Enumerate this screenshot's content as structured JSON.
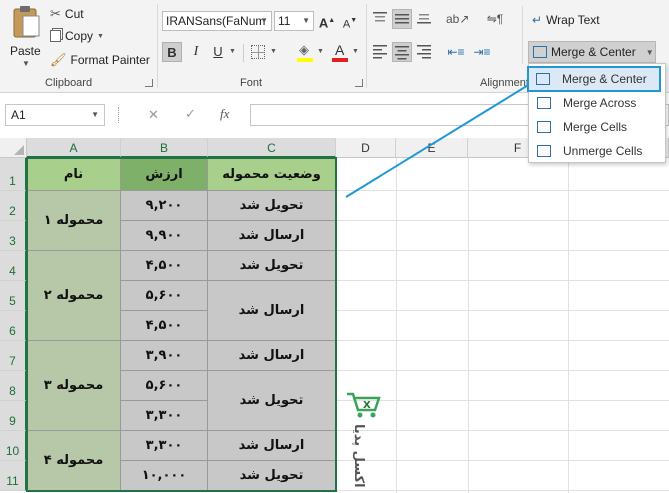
{
  "clipboard": {
    "paste_label": "Paste",
    "cut_label": "Cut",
    "copy_label": "Copy",
    "format_painter_label": "Format Painter",
    "group_label": "Clipboard"
  },
  "font": {
    "font_name": "IRANSans(FaNum",
    "font_size": "11",
    "group_label": "Font",
    "bold": "B",
    "italic": "I",
    "underline": "U",
    "grow": "A",
    "shrink": "A"
  },
  "alignment": {
    "wrap_text_label": "Wrap Text",
    "merge_center_label": "Merge & Center",
    "group_label": "Alignment"
  },
  "merge_menu": {
    "items": [
      {
        "label": "Merge & Center"
      },
      {
        "label": "Merge Across"
      },
      {
        "label": "Merge Cells"
      },
      {
        "label": "Unmerge Cells"
      }
    ]
  },
  "formula_bar": {
    "name_box": "A1",
    "fx": "fx",
    "cancel": "✕",
    "enter": "✓",
    "value": ""
  },
  "columns": [
    "A",
    "B",
    "C",
    "D",
    "E",
    "F"
  ],
  "rows": [
    "1",
    "2",
    "3",
    "4",
    "5",
    "6",
    "7",
    "8",
    "9",
    "10",
    "11"
  ],
  "table": {
    "headers": {
      "name": "نام",
      "value": "ارزش",
      "status": "وضعیت محموله"
    },
    "shipment_1": "محموله ۱",
    "shipment_2": "محموله ۲",
    "shipment_3": "محموله ۳",
    "shipment_4": "محموله ۴",
    "values": [
      "۹,۲۰۰",
      "۹,۹۰۰",
      "۴,۵۰۰",
      "۵,۶۰۰",
      "۴,۵۰۰",
      "۳,۹۰۰",
      "۵,۶۰۰",
      "۳,۳۰۰",
      "۳,۳۰۰",
      "۱۰,۰۰۰"
    ],
    "status_delivered": "تحویل شد",
    "status_sent": "ارسال شد"
  },
  "watermark": {
    "text": "اکسل پدیا"
  },
  "colors": {
    "excel_green": "#217346",
    "header_green": "#a9cf8c",
    "header_green_dark": "#7fb06a",
    "highlight_blue": "#2196d3"
  }
}
